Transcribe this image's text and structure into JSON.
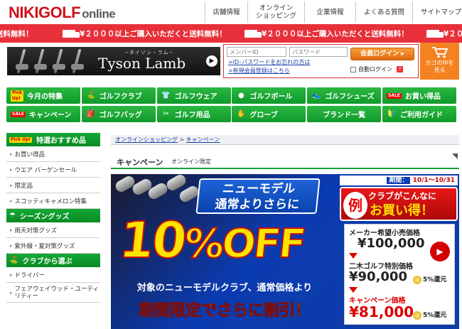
{
  "header": {
    "logo_main": "NIKIGOLF",
    "logo_sub": "online",
    "nav": [
      "店舗情報",
      "オンライン\nショッピング",
      "企業情報",
      "よくある質問",
      "サイトマップ"
    ]
  },
  "banner": {
    "segments": [
      {
        "text": "送料無料！"
      },
      {
        "text": "¥２０００以上ご購入いただくと送料無料！"
      },
      {
        "text": "¥２０００以上ご購入いただくと送料無料！"
      },
      {
        "text": "¥２０００以上ご購入いただくと送料無料！"
      },
      {
        "text": "¥２０"
      }
    ]
  },
  "brand": {
    "kana": "−タイソン・ラム−",
    "name": "Tyson Lamb",
    "arrow_icon": "play-arrow"
  },
  "login": {
    "member_id_placeholder": "メンバーID",
    "password_placeholder": "パスワード",
    "login_button": "会員ログイン ▸",
    "forgot_link": ">ID･パスワードをお忘れの方は",
    "register_link": ">新規会員登録はこちら",
    "auto_login": "自動ログイン",
    "help": "?"
  },
  "cart": {
    "line1": "カゴの中を",
    "line2": "見る"
  },
  "green_nav": {
    "row1": [
      {
        "label": "今月の特集",
        "icon": "pickup-tag"
      },
      {
        "label": "ゴルフクラブ",
        "icon": "golf-club-icon"
      },
      {
        "label": "ゴルフウェア",
        "icon": "shirt-icon"
      },
      {
        "label": "ゴルフボール",
        "icon": "ball-icon"
      },
      {
        "label": "ゴルフシューズ",
        "icon": "shoe-icon"
      },
      {
        "label": "お買い得品",
        "icon": "sale-tag"
      }
    ],
    "row2": [
      {
        "label": "キャンペーン",
        "icon": "sale-tag"
      },
      {
        "label": "ゴルフバッグ",
        "icon": "bag-icon"
      },
      {
        "label": "ゴルフ用品",
        "icon": "tools-icon"
      },
      {
        "label": "グローブ",
        "icon": "glove-icon"
      },
      {
        "label": "ブランド一覧",
        "icon": ""
      },
      {
        "label": "ご利用ガイド",
        "icon": "guide-icon"
      }
    ]
  },
  "sidebar": {
    "sections": [
      {
        "title": "特選おすすめ品",
        "tag": "Pick Up!",
        "items": [
          "お買い得品",
          "ウエア バーゲンセール",
          "限定品",
          "スコッティキャメロン特集"
        ]
      },
      {
        "title": "シーズングッズ",
        "tag": "",
        "items": [
          "雨天対策グッズ",
          "紫外線・夏対策グッズ"
        ]
      },
      {
        "title": "クラブから選ぶ",
        "tag": "",
        "items": [
          "ドライバー",
          "フェアウェイウッド・ユーティリティー"
        ]
      }
    ]
  },
  "breadcrumb": {
    "home": "オンラインショッピング",
    "sep": " > ",
    "current": "キャンペーン"
  },
  "page": {
    "title": "キャンペーン",
    "subtitle": "オンライン限定"
  },
  "campaign": {
    "headline1": "ニューモデル",
    "headline2": "通常よりさらに",
    "big_number": "10",
    "big_percent": "%",
    "big_off": "OFF",
    "sub1": "対象のニューモデルクラブ、通常価格より",
    "sub2": "期間限定でさらに割引！",
    "period_label": "期間：",
    "period": "10/1～10/31",
    "rei": "例",
    "box_head1": "クラブがこんなに",
    "box_head2": "お買い得！",
    "price1_label": "メーカー希望小売価格",
    "price1": "¥100,000",
    "price2_label": "二木ゴルフ特別価格",
    "price2": "¥90,000",
    "price2_note": "5%還元",
    "price3_label": "キャンペーン価格",
    "price3": "¥81,000",
    "price3_note": "5%還元"
  },
  "colors": {
    "brand_red": "#d0121b",
    "banner_red": "#e8303a",
    "nav_green": "#14a534",
    "cart_orange": "#f58220",
    "campaign_blue": "#0d3da6",
    "price_red": "#d20000"
  }
}
